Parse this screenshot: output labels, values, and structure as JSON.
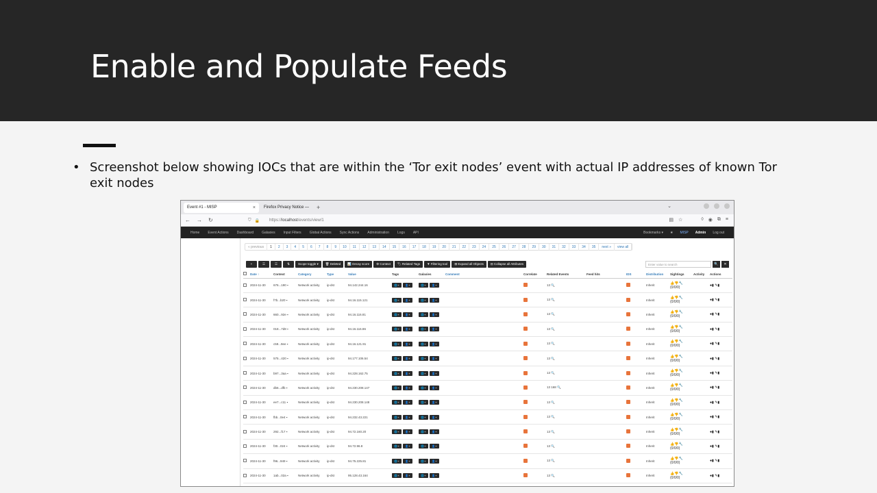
{
  "slide": {
    "title": "Enable and Populate Feeds",
    "bullet": "Screenshot below showing IOCs that are within the ‘Tor exit nodes’ event with actual IP addresses of known Tor exit nodes"
  },
  "browser": {
    "tabs": [
      {
        "label": "Event #1 - MISP",
        "active": true
      },
      {
        "label": "Firefox Privacy Notice —",
        "active": false
      }
    ],
    "url_prefix": "https://",
    "url_host": "localhost",
    "url_path": "/events/view/1"
  },
  "misp_nav": {
    "items": [
      "Home",
      "Event Actions",
      "Dashboard",
      "Galaxies",
      "Input Filters",
      "Global Actions",
      "Sync Actions",
      "Administration",
      "Logs",
      "API"
    ],
    "right": {
      "bookmarks": "Bookmarks ▾",
      "star": "★",
      "misp": "MISP",
      "admin": "Admin",
      "logout": "Log out"
    }
  },
  "pager": {
    "prev": "« previous",
    "pages": [
      "1",
      "2",
      "3",
      "4",
      "5",
      "6",
      "7",
      "8",
      "9",
      "10",
      "11",
      "12",
      "13",
      "14",
      "15",
      "16",
      "17",
      "18",
      "19",
      "20",
      "21",
      "22",
      "23",
      "24",
      "25",
      "26",
      "27",
      "28",
      "29",
      "30",
      "31",
      "32",
      "33",
      "34",
      "35"
    ],
    "next": "next »",
    "all": "view all"
  },
  "toolbar": {
    "plus": "+",
    "list": "☰",
    "filter": "☰",
    "sort": "⇅",
    "scope": "Scope toggle ▾",
    "deleted": "🗑 Deleted",
    "decay": "📊 Decay score",
    "context": "⚙ Context",
    "related_tags": "🏷 Related Tags",
    "filtering": "▼ Filtering tool",
    "expand": "⊞ Expand all Objects",
    "collapse": "⊟ Collapse all Attributes",
    "search_placeholder": "Enter value to search",
    "search_btn": "🔍",
    "clear_btn": "✕"
  },
  "columns": {
    "date": "Date ↑",
    "context": "Context",
    "category": "Category",
    "type": "Type",
    "value": "Value",
    "tags": "Tags",
    "galaxies": "Galaxies",
    "comment": "Comment",
    "correlate": "Correlate",
    "related": "Related Events",
    "feed": "Feed hits",
    "ids": "IDS",
    "distribution": "Distribution",
    "sightings": "Sightings",
    "activity": "Activity",
    "actions": "Actions"
  },
  "rows": [
    {
      "date": "2024-11-30",
      "context": "676...190",
      "category": "Network activity",
      "type": "ip-dst",
      "value": "94.142.244.16",
      "related": "13",
      "distribution": "Inherit"
    },
    {
      "date": "2024-11-30",
      "context": "f7b...b20",
      "category": "Network activity",
      "type": "ip-dst",
      "value": "94.16.115.121",
      "related": "13",
      "distribution": "Inherit"
    },
    {
      "date": "2024-11-30",
      "context": "660...92e",
      "category": "Network activity",
      "type": "ip-dst",
      "value": "94.16.116.81",
      "related": "13",
      "distribution": "Inherit"
    },
    {
      "date": "2024-11-30",
      "context": "018...7d8",
      "category": "Network activity",
      "type": "ip-dst",
      "value": "94.16.116.86",
      "related": "13",
      "distribution": "Inherit"
    },
    {
      "date": "2024-11-30",
      "context": "c59...9ee",
      "category": "Network activity",
      "type": "ip-dst",
      "value": "94.16.121.91",
      "related": "13",
      "distribution": "Inherit"
    },
    {
      "date": "2024-11-30",
      "context": "575...420",
      "category": "Network activity",
      "type": "ip-dst",
      "value": "94.177.106.54",
      "related": "13",
      "distribution": "Inherit"
    },
    {
      "date": "2024-11-30",
      "context": "b97...3aa",
      "category": "Network activity",
      "type": "ip-dst",
      "value": "94.228.162.75",
      "related": "13",
      "distribution": "Inherit"
    },
    {
      "date": "2024-11-30",
      "context": "db6...dfb",
      "category": "Network activity",
      "type": "ip-dst",
      "value": "94.230.208.147",
      "related": "13 168",
      "distribution": "Inherit"
    },
    {
      "date": "2024-11-30",
      "context": "ee7...c11",
      "category": "Network activity",
      "type": "ip-dst",
      "value": "94.230.208.148",
      "related": "13",
      "distribution": "Inherit"
    },
    {
      "date": "2024-11-30",
      "context": "fbb...0e4",
      "category": "Network activity",
      "type": "ip-dst",
      "value": "94.232.43.221",
      "related": "13",
      "distribution": "Inherit"
    },
    {
      "date": "2024-11-30",
      "context": "292...f17",
      "category": "Network activity",
      "type": "ip-dst",
      "value": "94.72.160.20",
      "related": "13",
      "distribution": "Inherit"
    },
    {
      "date": "2024-11-30",
      "context": "f30...024",
      "category": "Network activity",
      "type": "ip-dst",
      "value": "94.72.96.8",
      "related": "13",
      "distribution": "Inherit"
    },
    {
      "date": "2024-11-30",
      "context": "f96...949",
      "category": "Network activity",
      "type": "ip-dst",
      "value": "94.75.225.81",
      "related": "13",
      "distribution": "Inherit"
    },
    {
      "date": "2024-11-30",
      "context": "1ab...02a",
      "category": "Network activity",
      "type": "ip-dst",
      "value": "95.128.43.164",
      "related": "13",
      "distribution": "Inherit"
    }
  ],
  "sightings_counts": "(0/0/0)",
  "colors": {
    "band": "#262626",
    "accent": "#e8743b",
    "date": "#c9302c",
    "link": "#337ab7"
  }
}
